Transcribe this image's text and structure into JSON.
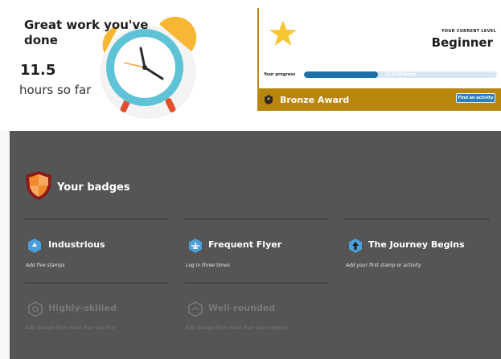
{
  "hero": {
    "title": "Great work you've done",
    "hours_value": "11.5",
    "hours_label": "hours so far"
  },
  "level": {
    "caption": "YOUR CURRENT LEVEL",
    "name": "Beginner",
    "progress_label": "Your progress",
    "progress_text": "11.5/30 hours",
    "progress_fraction": 0.383,
    "award_name": "Bronze Award",
    "find_activity_label": "Find an activity"
  },
  "badges": {
    "section_title": "Your badges",
    "earned": [
      {
        "title": "Industrious",
        "description": "Add five stamps"
      },
      {
        "title": "Frequent Flyer",
        "description": "Log in three times"
      },
      {
        "title": "The Journey Begins",
        "description": "Add your first stamp or activity"
      }
    ],
    "locked": [
      {
        "title": "Highly-skilled",
        "description": "Add stamps from more than one skill"
      },
      {
        "title": "Well-rounded",
        "description": "Add stamps from more than one category"
      }
    ]
  },
  "colors": {
    "panel": "#555555",
    "award": "#b8860b",
    "progress": "#1f6fa8",
    "badge_blue": "#4a9fd8",
    "shield_orange": "#f08a2c",
    "shield_dark": "#8b1a1a",
    "star_yellow": "#f7c531"
  }
}
